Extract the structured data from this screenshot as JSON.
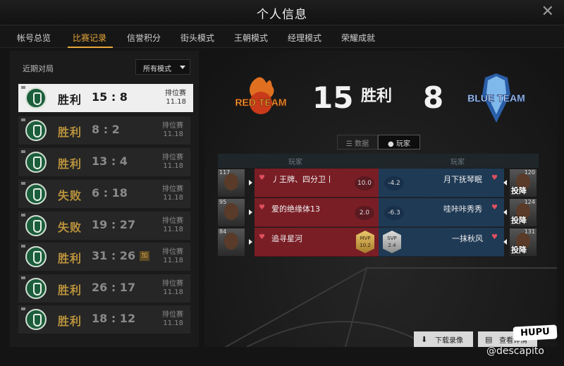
{
  "window": {
    "title": "个人信息",
    "close_symbol": "✕"
  },
  "tabs": [
    {
      "label": "帐号总览"
    },
    {
      "label": "比赛记录",
      "active": true
    },
    {
      "label": "信誉积分"
    },
    {
      "label": "街头模式"
    },
    {
      "label": "王朝模式"
    },
    {
      "label": "经理模式"
    },
    {
      "label": "荣耀成就"
    }
  ],
  "recent": {
    "label": "近期对局",
    "mode_select": "所有模式"
  },
  "matches": [
    {
      "result": "胜利",
      "score": "15 : 8",
      "type": "排位赛",
      "date": "11.18",
      "selected": true
    },
    {
      "result": "胜利",
      "score": "8 : 2",
      "type": "排位赛",
      "date": "11.18"
    },
    {
      "result": "胜利",
      "score": "13 : 4",
      "type": "排位赛",
      "date": "11.18"
    },
    {
      "result": "失败",
      "score": "6 : 18",
      "type": "排位赛",
      "date": "11.18"
    },
    {
      "result": "失败",
      "score": "19 : 27",
      "type": "排位赛",
      "date": "11.18"
    },
    {
      "result": "胜利",
      "score": "31 : 26",
      "type": "排位赛",
      "date": "11.18",
      "extra": "加"
    },
    {
      "result": "胜利",
      "score": "26 : 17",
      "type": "排位赛",
      "date": "11.18"
    },
    {
      "result": "胜利",
      "score": "18 : 12",
      "type": "排位赛",
      "date": "11.18"
    }
  ],
  "detail": {
    "red_team": "RED TEAM",
    "blue_team": "BLUE TEAM",
    "red_score": "15",
    "blue_score": "8",
    "result": "胜利",
    "seg_data": "数据",
    "seg_players": "玩家",
    "col_red": "玩家",
    "col_blue": "玩家",
    "red_players": [
      {
        "level": "117",
        "name": "丿王牌、四分卫丨",
        "rating": "10.0"
      },
      {
        "level": "95",
        "name": "爱的绝缘体13",
        "rating": "2.0"
      },
      {
        "level": "84",
        "name": "追寻星河",
        "badge": "MVP",
        "rating": "10.2"
      }
    ],
    "blue_players": [
      {
        "level": "120",
        "name": "月下抚琴眠",
        "rating": "-4.2",
        "status": "投降"
      },
      {
        "level": "124",
        "name": "哇咔咔秀秀",
        "rating": "-6.3",
        "status": "投降"
      },
      {
        "level": "131",
        "name": "一抹秋风",
        "badge": "SVP",
        "rating": "2.4",
        "status": "投降"
      }
    ]
  },
  "buttons": {
    "download": "下载录像",
    "view": "查看详情"
  },
  "watermark": {
    "hupu": "HUPU",
    "handle": "@descapito"
  },
  "colors": {
    "accent": "#e8a73a",
    "red_team": "#7a1e26",
    "blue_team": "#1f3a55"
  }
}
